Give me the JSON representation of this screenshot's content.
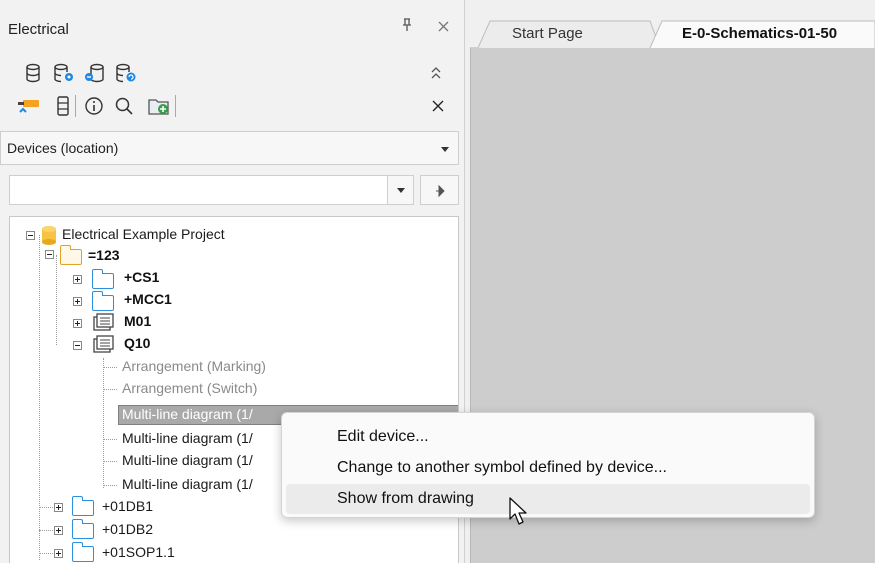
{
  "panel": {
    "title": "Electrical",
    "pin_icon": "pin-icon",
    "close_icon": "close-icon",
    "toolbar_row1": [
      "database-icon",
      "database-settings-icon",
      "database-link-icon",
      "database-refresh-icon"
    ],
    "toolbar_row2": [
      "device-connector-icon",
      "device-column-icon",
      "info-icon",
      "search-icon",
      "new-folder-icon"
    ],
    "collapse_icon": "collapse-up-icon",
    "toolbar_close_icon": "close-icon",
    "view_select": {
      "value": "Devices (location)"
    },
    "filter_select": {
      "value": ""
    },
    "go_icon": "arrow-right-icon"
  },
  "tree": {
    "project": "Electrical Example Project",
    "location": "=123",
    "items": [
      {
        "label": "+CS1"
      },
      {
        "label": "+MCC1"
      },
      {
        "label": "M01"
      },
      {
        "label": "Q10"
      }
    ],
    "children": [
      {
        "label": "Arrangement (Marking)"
      },
      {
        "label": "Arrangement (Switch)"
      },
      {
        "label": "Multi-line diagram (1/"
      },
      {
        "label": "Multi-line diagram (1/"
      },
      {
        "label": "Multi-line diagram (1/"
      },
      {
        "label": "Multi-line diagram (1/"
      }
    ],
    "bottom": [
      {
        "label": "+01DB1"
      },
      {
        "label": "+01DB2"
      },
      {
        "label": "+01SOP1.1"
      }
    ]
  },
  "tabs": [
    {
      "label": "Start Page"
    },
    {
      "label": "E-0-Schematics-01-50"
    }
  ],
  "context_menu": {
    "items": [
      {
        "label": "Edit device..."
      },
      {
        "label": "Change to another symbol defined by device..."
      },
      {
        "label": "Show from drawing"
      }
    ]
  },
  "colors": {
    "folder": "#2b8fe0",
    "folder_open": "#e0a326",
    "workspace": "#cdcdcd",
    "selection": "#a9a9a9"
  }
}
